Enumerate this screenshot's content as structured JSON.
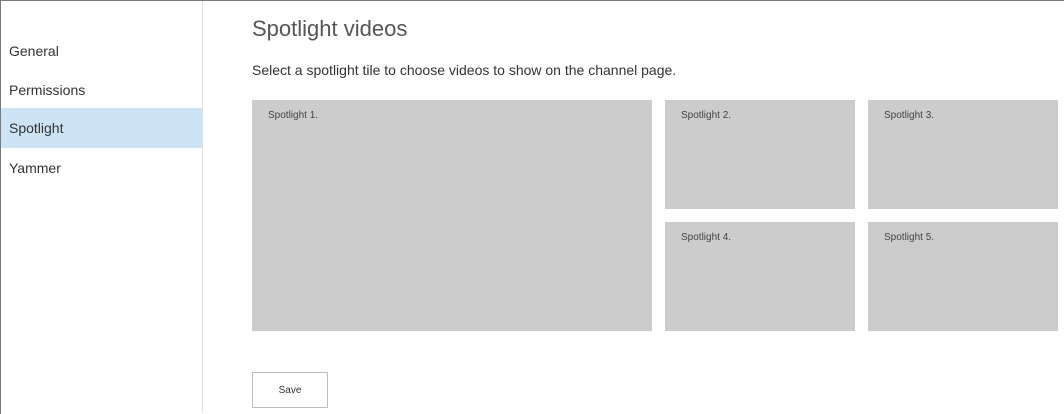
{
  "sidebar": {
    "items": [
      {
        "label": "General",
        "selected": false
      },
      {
        "label": "Permissions",
        "selected": false
      },
      {
        "label": "Spotlight",
        "selected": true
      },
      {
        "label": "Yammer",
        "selected": false
      }
    ]
  },
  "main": {
    "title": "Spotlight videos",
    "description": "Select a spotlight tile to choose videos to show on the channel page.",
    "tiles": [
      {
        "label": "Spotlight 1."
      },
      {
        "label": "Spotlight 2."
      },
      {
        "label": "Spotlight 3."
      },
      {
        "label": "Spotlight 4."
      },
      {
        "label": "Spotlight 5."
      }
    ],
    "save_label": "Save"
  },
  "colors": {
    "selected_nav_bg": "#cce4f6",
    "tile_bg": "#cccccc"
  }
}
